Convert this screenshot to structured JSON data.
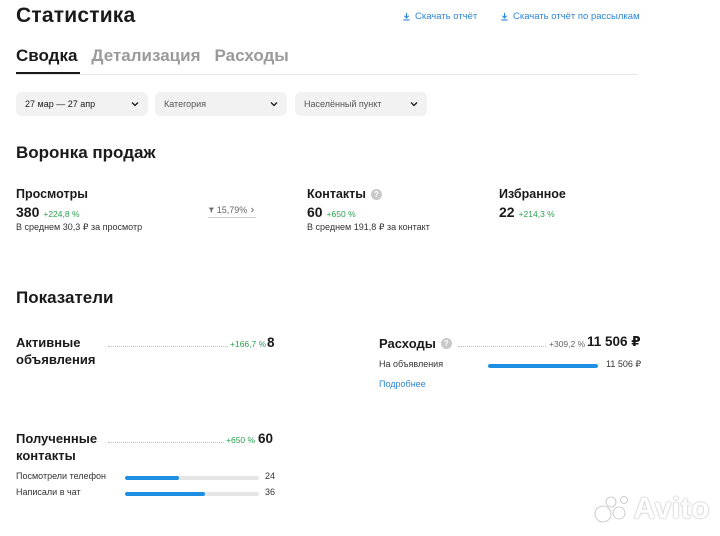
{
  "header": {
    "title": "Статистика",
    "download_report": "Скачать отчёт",
    "download_mailing_report": "Скачать отчёт по рассылкам"
  },
  "tabs": [
    {
      "label": "Сводка",
      "active": true
    },
    {
      "label": "Детализация",
      "active": false
    },
    {
      "label": "Расходы",
      "active": false
    }
  ],
  "filters": {
    "date_range": "27 мар — 27 апр",
    "category": "Категория",
    "locality": "Населённый пункт"
  },
  "funnel": {
    "title": "Воронка продаж",
    "views": {
      "label": "Просмотры",
      "value": "380",
      "delta": "+224,8 %",
      "sub": "В среднем 30,3 ₽ за просмотр"
    },
    "conversion": "15,79%",
    "contacts": {
      "label": "Контакты",
      "value": "60",
      "delta": "+650 %",
      "sub": "В среднем 191,8 ₽ за контакт"
    },
    "favorites": {
      "label": "Избранное",
      "value": "22",
      "delta": "+214,3 %"
    }
  },
  "indicators": {
    "title": "Показатели",
    "active_ads": {
      "label": "Активные объявления",
      "delta": "+166,7 %",
      "value": "8"
    },
    "expenses": {
      "label": "Расходы",
      "delta": "+309,2 %",
      "value": "11 506 ₽",
      "rows": [
        {
          "label": "На объявления",
          "value": "11 506 ₽",
          "fraction": 1.0
        }
      ],
      "more_link": "Подробнее"
    },
    "received_contacts": {
      "label": "Полученные контакты",
      "delta": "+650 %",
      "value": "60",
      "rows": [
        {
          "label": "Посмотрели телефон",
          "value": "24",
          "fraction": 0.4
        },
        {
          "label": "Написали в чат",
          "value": "36",
          "fraction": 0.6
        }
      ]
    }
  },
  "watermark": {
    "text": "Avito"
  },
  "colors": {
    "accent": "#2f86d6",
    "positive": "#2aa14f",
    "bar": "#1f8fe3"
  }
}
